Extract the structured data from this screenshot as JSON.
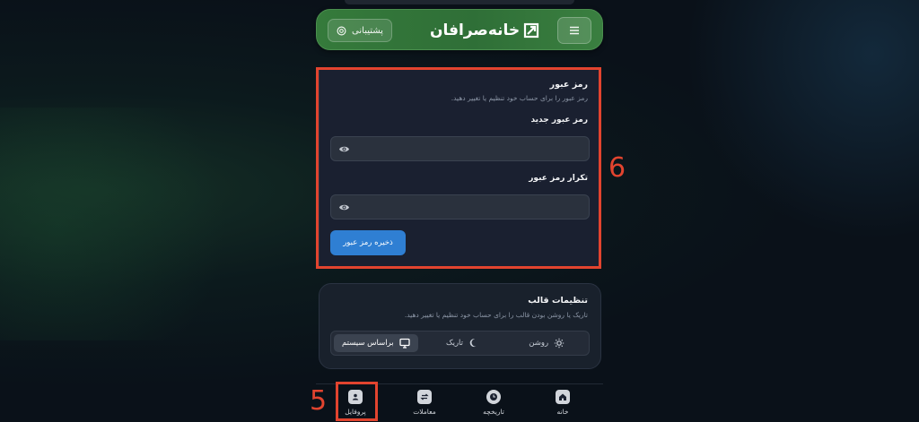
{
  "header": {
    "support_label": "پشتیبانی",
    "logo_text": "خانه‌صرافان",
    "support_icon": "support-icon",
    "menu_icon": "hamburger-menu-icon"
  },
  "password_card": {
    "title": "رمز عبور",
    "description": "رمز عبور را برای حساب خود تنظیم یا تغییر دهید.",
    "new_password_label": "رمز عبور جدید",
    "new_password_value": "",
    "confirm_password_label": "تکرار رمز عبور",
    "confirm_password_value": "",
    "save_label": "ذخیره رمز عبور"
  },
  "theme_card": {
    "title": "تنظیمات قالب",
    "description": "تاریک یا روشن بودن قالب را برای حساب خود تنظیم یا تغییر دهید.",
    "options": [
      "روشن",
      "تاریک",
      "براساس سیستم"
    ],
    "selected": "براساس سیستم"
  },
  "bottom_nav": {
    "items": [
      "خانه",
      "تاریخچه",
      "معاملات",
      "پروفایل"
    ],
    "active": "پروفایل"
  },
  "annotations": {
    "marker_6": "6",
    "marker_5": "5"
  },
  "colors": {
    "accent_green": "#357a3b",
    "primary_blue": "#2f7fd3",
    "highlight_red": "#e2442f",
    "card_bg": "#1a2130"
  }
}
